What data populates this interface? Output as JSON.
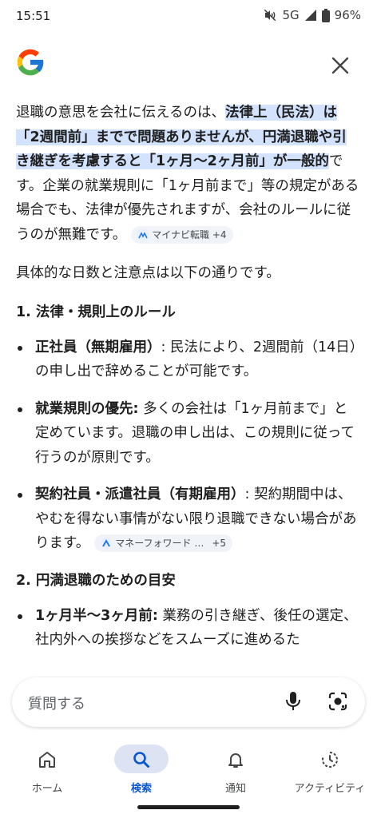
{
  "status_bar": {
    "time": "15:51",
    "network": "5G",
    "battery": "96%"
  },
  "answer": {
    "intro_before": "退職の意思を会社に伝えるのは、",
    "intro_highlight": "法律上（民法）は「2週間前」までで問題ありませんが、円満退職や引き継ぎを考慮すると「1ヶ月〜2ヶ月前」が一般的",
    "intro_after": "です。企業の就業規則に「1ヶ月前まで」等の規定がある場合でも、法律が優先されますが、会社のルールに従うのが無難です。",
    "source_chip_1": "マイナビ転職 +4",
    "lead": "具体的な日数と注意点は以下の通りです。",
    "section1_title": "1. 法律・規則上のルール",
    "section1_items": [
      {
        "term": "正社員（無期雇用）",
        "text": ": 民法により、2週間前（14日）の申し出で辞めることが可能です。"
      },
      {
        "term": "就業規則の優先:",
        "text": " 多くの会社は「1ヶ月前まで」と定めています。退職の申し出は、この規則に従って行うのが原則です。"
      },
      {
        "term": "契約社員・派遣社員（有期雇用）",
        "text": ": 契約期間中は、やむを得ない事情がない限り退職できない場合があります。"
      }
    ],
    "source_chip_2_name": "マネーフォワード …",
    "source_chip_2_count": "+5",
    "section2_title": "2. 円満退職のための目安",
    "section2_items": [
      {
        "term": "1ヶ月半〜3ヶ月前:",
        "text": " 業務の引き継ぎ、後任の選定、社内外への挨拶などをスムーズに進めるた"
      }
    ]
  },
  "ask_bar": {
    "placeholder": "質問する"
  },
  "bottom_nav": {
    "items": [
      {
        "label": "ホーム",
        "icon": "home-icon"
      },
      {
        "label": "検索",
        "icon": "search-icon",
        "active": true
      },
      {
        "label": "通知",
        "icon": "bell-icon"
      },
      {
        "label": "アクティビティ",
        "icon": "activity-icon"
      }
    ]
  },
  "colors": {
    "highlight": "#d3e3fd",
    "accent": "#0b57d0",
    "active_pill": "#dde3f3"
  }
}
